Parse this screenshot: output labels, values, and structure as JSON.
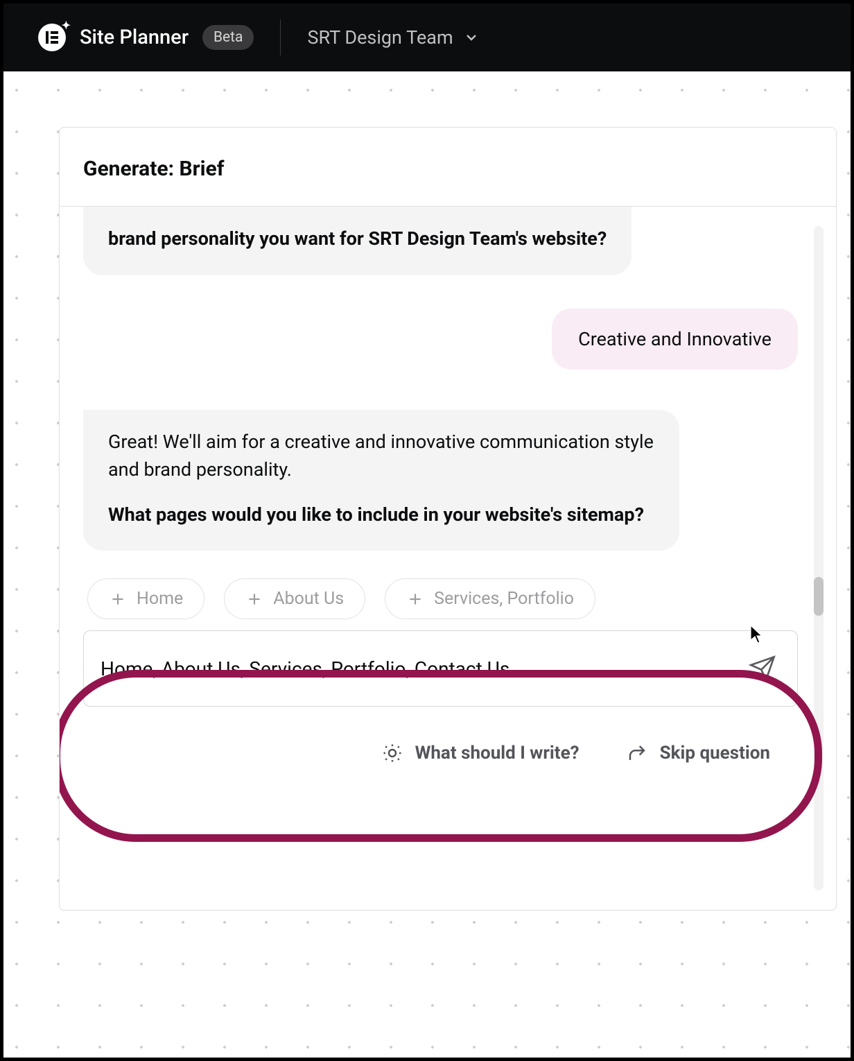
{
  "header": {
    "app_title": "Site Planner",
    "beta_label": "Beta",
    "team_name": "SRT Design Team"
  },
  "panel": {
    "title": "Generate: Brief"
  },
  "chat": {
    "bot1_strong": "brand personality you want for SRT Design Team's website?",
    "user1": "Creative and Innovative",
    "bot2_p1": "Great! We'll aim for a creative and innovative communication style and brand personality.",
    "bot2_p2_strong": "What pages would you like to include in your website's sitemap?"
  },
  "suggestions": [
    "Home",
    "About Us",
    "Services, Portfolio"
  ],
  "input": {
    "value": "Home, About Us, Services, Portfolio, Contact Us"
  },
  "helpers": {
    "hint": "What should I write?",
    "skip": "Skip question"
  }
}
